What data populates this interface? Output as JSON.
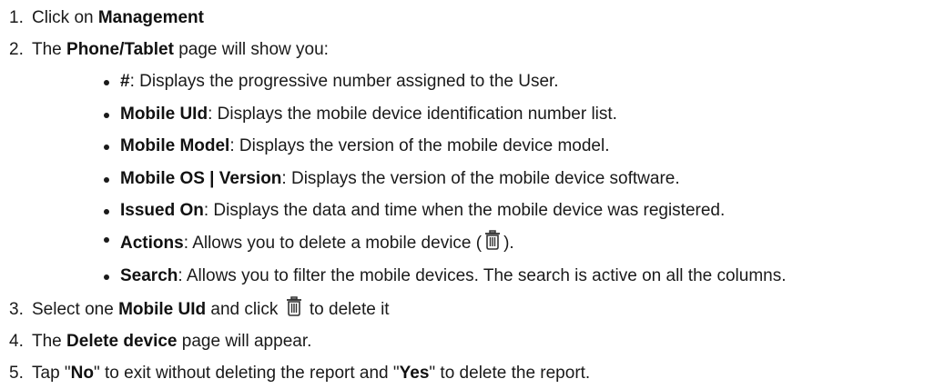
{
  "steps": [
    {
      "num": "1.",
      "pre": "Click on ",
      "bold": "Management",
      "post": ""
    },
    {
      "num": "2.",
      "pre": "The ",
      "bold": "Phone/Tablet",
      "post": " page will show you:"
    },
    {
      "num": "3.",
      "pre": "Select one ",
      "bold": "Mobile UId",
      "mid": " and click ",
      "post": " to delete it"
    },
    {
      "num": "4.",
      "pre": "The ",
      "bold": "Delete device",
      "post": " page will appear."
    },
    {
      "num": "5.",
      "pre": "Tap \"",
      "bold": "No",
      "mid": "\" to exit without deleting the report and \"",
      "bold2": "Yes",
      "post": "\" to delete the report."
    }
  ],
  "bullets": [
    {
      "term": "#",
      "desc": ": Displays the progressive number assigned to the User."
    },
    {
      "term": "Mobile UId",
      "desc": ": Displays the mobile device identification number list."
    },
    {
      "term": "Mobile Model",
      "desc": ": Displays the version of the mobile device model."
    },
    {
      "term": "Mobile OS | Version",
      "desc": ": Displays the version of the mobile device software."
    },
    {
      "term": "Issued On",
      "desc": ": Displays the data and time when the mobile device was registered."
    },
    {
      "term": "Actions",
      "desc_pre": ": Allows you to delete a mobile device (",
      "desc_post": ")."
    },
    {
      "term": "Search",
      "desc": ": Allows you to filter the mobile devices. The search is active on all the columns."
    }
  ],
  "icons": {
    "delete": "trash-icon"
  }
}
